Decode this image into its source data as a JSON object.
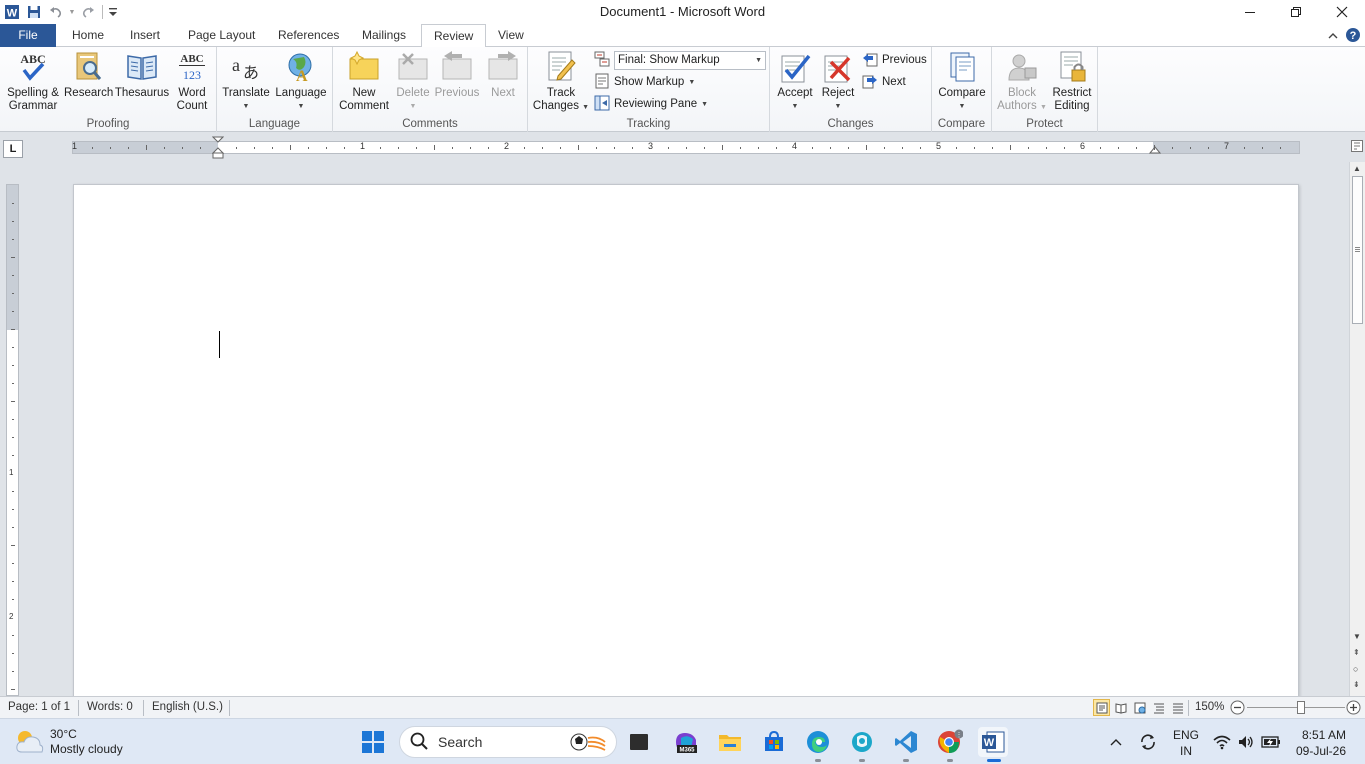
{
  "window": {
    "title": "Document1  -  Microsoft Word"
  },
  "tabs": {
    "file": "File",
    "items": [
      "Home",
      "Insert",
      "Page Layout",
      "References",
      "Mailings",
      "Review",
      "View"
    ],
    "active": "Review"
  },
  "ribbon": {
    "proofing": {
      "label": "Proofing",
      "spelling": "Spelling &",
      "spelling2": "Grammar",
      "research": "Research",
      "thesaurus": "Thesaurus",
      "word_count": "Word",
      "word_count2": "Count"
    },
    "language": {
      "label": "Language",
      "translate": "Translate",
      "language": "Language"
    },
    "comments": {
      "label": "Comments",
      "new_comment": "New",
      "new_comment2": "Comment",
      "delete": "Delete",
      "previous": "Previous",
      "next": "Next"
    },
    "tracking": {
      "label": "Tracking",
      "track_changes": "Track",
      "track_changes2": "Changes",
      "display_select": "Final: Show Markup",
      "show_markup": "Show Markup",
      "reviewing_pane": "Reviewing Pane"
    },
    "changes": {
      "label": "Changes",
      "accept": "Accept",
      "reject": "Reject",
      "previous": "Previous",
      "next": "Next"
    },
    "compare": {
      "label": "Compare",
      "compare": "Compare"
    },
    "protect": {
      "label": "Protect",
      "block_authors": "Block",
      "block_authors2": "Authors",
      "restrict_editing": "Restrict",
      "restrict_editing2": "Editing"
    }
  },
  "ruler": {
    "corner": "L",
    "numbers": [
      "1",
      "1",
      "2",
      "3",
      "4",
      "5",
      "6",
      "7"
    ],
    "vnumbers": [
      "1",
      "2"
    ]
  },
  "statusbar": {
    "page": "Page: 1 of 1",
    "words": "Words: 0",
    "language": "English (U.S.)",
    "zoom": "150%"
  },
  "taskbar": {
    "weather_temp": "30°C",
    "weather_desc": "Mostly cloudy",
    "search_placeholder": "Search",
    "lang_top": "ENG",
    "lang_bottom": "IN",
    "time": "8:51 AM",
    "date": "09-Jul-26"
  },
  "colors": {
    "file_tab": "#2b5797",
    "accent_blue": "#1a6bd6",
    "word_blue": "#2b5797"
  }
}
